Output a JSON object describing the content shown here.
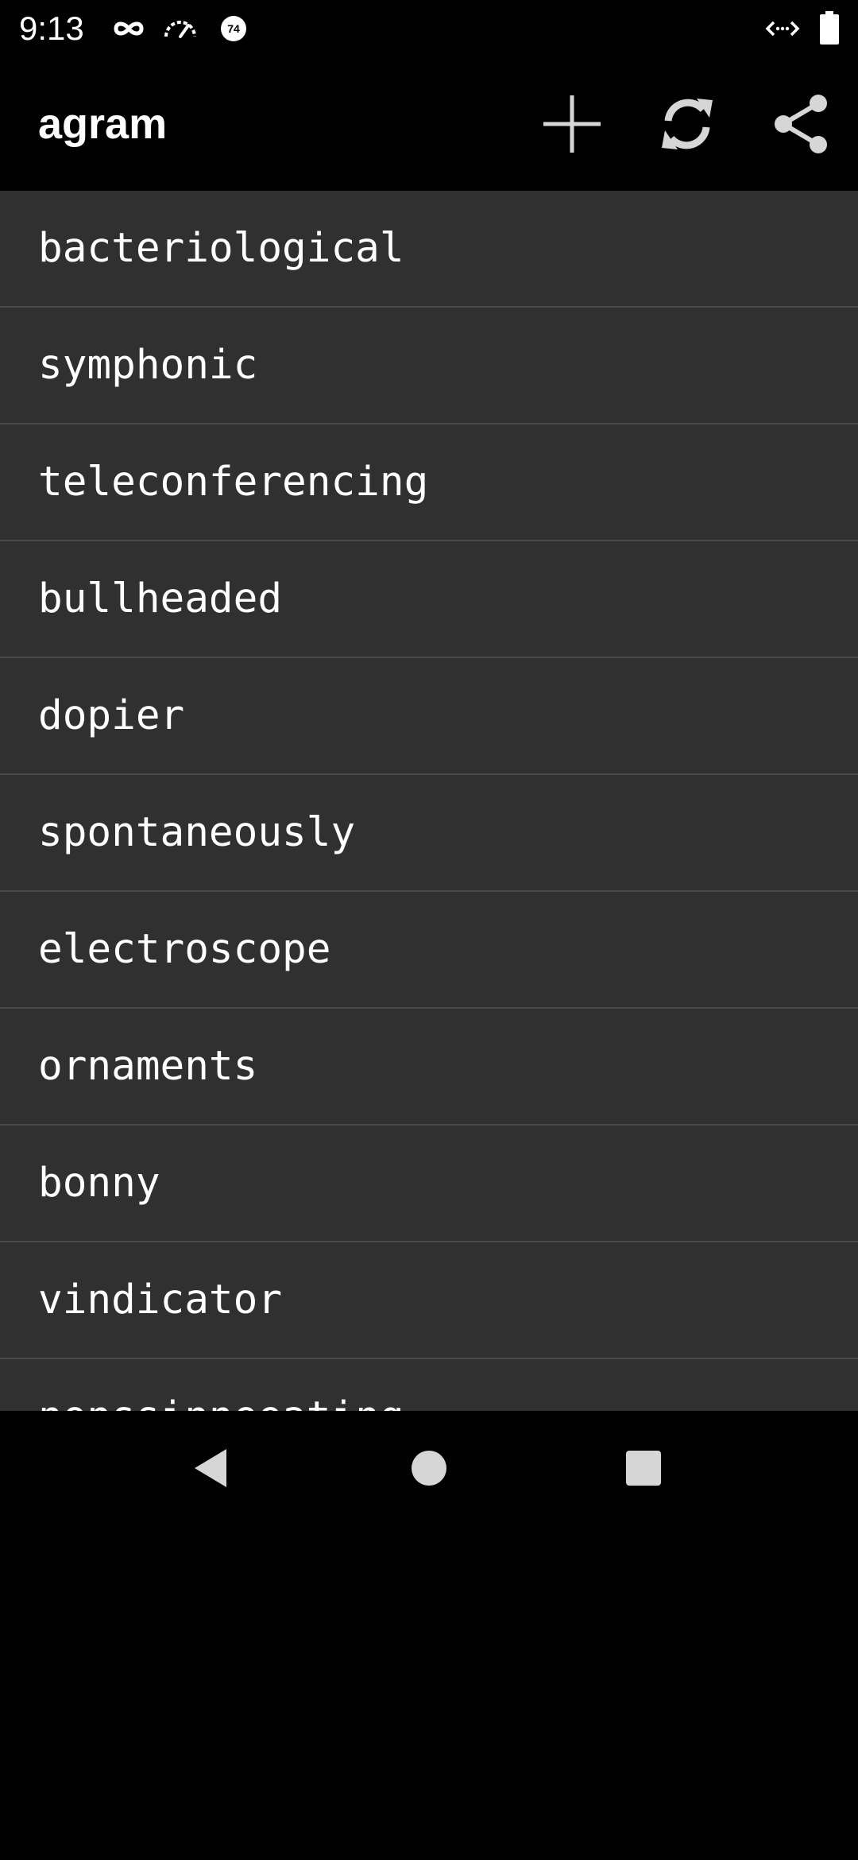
{
  "status_bar": {
    "time": "9:13",
    "left_icons": [
      "infinity-icon",
      "speedometer-icon",
      "badge-74-icon"
    ],
    "badge_text": "74",
    "right_icons": [
      "data-transfer-icon",
      "battery-icon"
    ]
  },
  "app_bar": {
    "title": "agram",
    "actions": [
      "add-icon",
      "refresh-icon",
      "share-icon"
    ]
  },
  "list": {
    "items": [
      {
        "label": "bacteriological"
      },
      {
        "label": "symphonic"
      },
      {
        "label": "teleconferencing"
      },
      {
        "label": "bullheaded"
      },
      {
        "label": "dopier"
      },
      {
        "label": "spontaneously"
      },
      {
        "label": "electroscope"
      },
      {
        "label": "ornaments"
      },
      {
        "label": "bonny"
      },
      {
        "label": "vindicator"
      },
      {
        "label": "nonssinneeating"
      }
    ]
  },
  "colors": {
    "background": "#000000",
    "list_background": "#303030",
    "divider": "#4a4a4a",
    "text": "#ffffff",
    "icon": "#d6d6d6"
  },
  "nav_bar": {
    "buttons": [
      "back-icon",
      "home-icon",
      "recents-icon"
    ]
  }
}
